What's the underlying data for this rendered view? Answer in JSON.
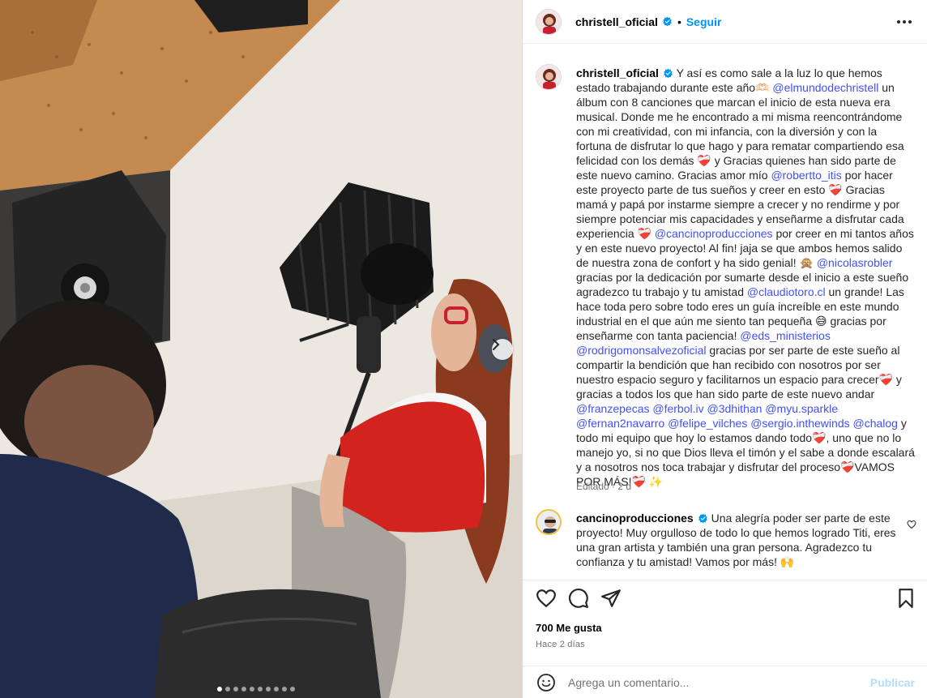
{
  "post": {
    "username": "christell_oficial",
    "separator": "•",
    "follow_label": "Seguir",
    "caption": {
      "username": "christell_oficial",
      "segments": [
        {
          "t": " Y así es como sale a la luz lo que hemos estado trabajando durante este año🫶🏻 "
        },
        {
          "m": "@elmundodechristell"
        },
        {
          "t": " un álbum con 8 canciones que marcan el inicio de esta nueva era musical. Donde me he encontrado a mi misma reencontrándome con mi creatividad, con mi infancia, con la diversión y con la fortuna de disfrutar lo que hago y para rematar compartiendo esa felicidad con los demás ❤️‍🩹 y Gracias quienes han sido parte de este nuevo camino. Gracias amor mío "
        },
        {
          "m": "@robertto_itis"
        },
        {
          "t": " por hacer este proyecto parte de tus sueños y creer en esto ❤️‍🩹 Gracias mamá y papá por instarme siempre a crecer y no rendirme y por siempre potenciar mis capacidades y enseñarme a disfrutar cada experiencia ❤️‍🩹 "
        },
        {
          "m": "@cancinoproducciones"
        },
        {
          "t": " por creer en mi tantos años y en este nuevo proyecto! Al fin! jaja se que ambos hemos salido de nuestra zona de confort y ha sido genial! 🙊 "
        },
        {
          "m": "@nicolasrobler"
        },
        {
          "t": " gracias por la dedicación por sumarte desde el inicio a este sueño agradezco tu trabajo y tu amistad "
        },
        {
          "m": "@claudiotoro.cl"
        },
        {
          "t": " un grande! Las hace toda pero sobre todo eres un guía increíble en este mundo industrial en el que aún me siento tan pequeña 😅 gracias por enseñarme con tanta paciencia! "
        },
        {
          "m": "@eds_ministerios"
        },
        {
          "t": " "
        },
        {
          "m": "@rodrigomonsalvezoficial"
        },
        {
          "t": " gracias por ser parte de este sueño al compartir la bendición que han recibido con nosotros por ser nuestro espacio seguro y facilitarnos un espacio para crecer❤️‍🩹 y gracias a todos los que han sido parte de este nuevo andar "
        },
        {
          "m": "@franzepecas"
        },
        {
          "t": " "
        },
        {
          "m": "@ferbol.iv"
        },
        {
          "t": " "
        },
        {
          "m": "@3dhithan"
        },
        {
          "t": " "
        },
        {
          "m": "@myu.sparkle"
        },
        {
          "t": " "
        },
        {
          "m": "@fernan2navarro"
        },
        {
          "t": " "
        },
        {
          "m": "@felipe_vilches"
        },
        {
          "t": " "
        },
        {
          "m": "@sergio.inthewinds"
        },
        {
          "t": " "
        },
        {
          "m": "@chalog"
        },
        {
          "t": " y todo mi equipo que hoy lo estamos dando todo❤️‍🩹, uno que no lo manejo yo, si no que Dios lleva el timón y el sabe a donde escalará y a nosotros nos toca trabajar y disfrutar del proceso❤️‍🩹VAMOS POR MÁS!❤️‍🩹 ✨"
        }
      ],
      "meta": "Editado · 2 d"
    },
    "comment": {
      "username": "cancinoproducciones",
      "text": " Una alegría poder ser parte de este proyecto! Muy orgulloso de todo lo que hemos logrado Titi, eres una gran artista y también una gran persona. Agradezco tu confianza y tu amistad! Vamos por más! 🙌"
    },
    "likes": "700 Me gusta",
    "time_ago": "Hace 2 días",
    "comment_placeholder": "Agrega un comentario...",
    "publish_label": "Publicar",
    "carousel": {
      "total": 10,
      "active": 0
    }
  },
  "colors": {
    "accent": "#0095f6",
    "mention": "#4150f7",
    "verified": "#0095f6",
    "publish_disabled": "#b3dbff"
  },
  "icons": [
    "verified-icon",
    "more-icon",
    "heart-icon",
    "comment-icon",
    "share-icon",
    "bookmark-icon",
    "emoji-icon",
    "chevron-right-icon"
  ]
}
